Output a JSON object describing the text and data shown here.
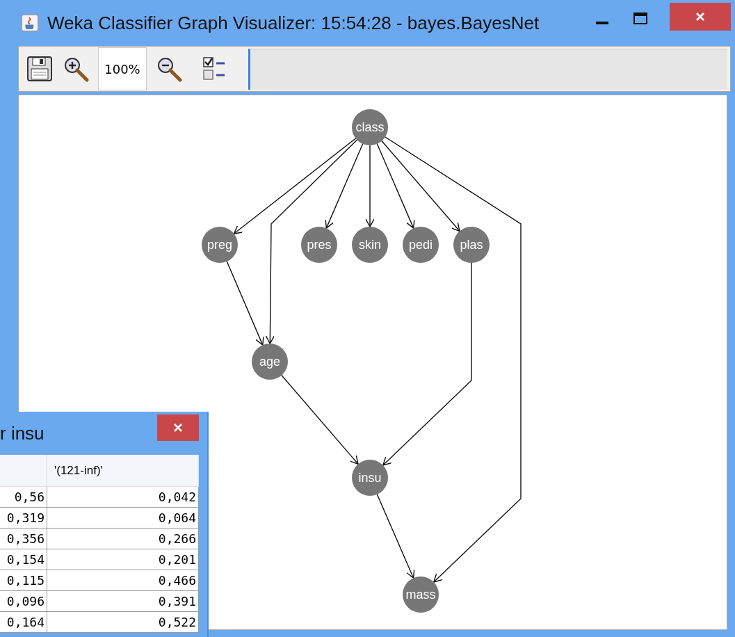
{
  "window": {
    "title": "Weka Classifier Graph Visualizer: 15:54:28 - bayes.BayesNet"
  },
  "toolbar": {
    "zoom": "100%"
  },
  "graph": {
    "nodes": [
      "class",
      "preg",
      "pres",
      "skin",
      "pedi",
      "plas",
      "age",
      "insu",
      "mass"
    ]
  },
  "table_window": {
    "title": "r insu",
    "columns": [
      "",
      "'(121-inf)'"
    ],
    "rows": [
      [
        "0,56",
        "0,042"
      ],
      [
        "0,319",
        "0,064"
      ],
      [
        "0,356",
        "0,266"
      ],
      [
        "0,154",
        "0,201"
      ],
      [
        "0,115",
        "0,466"
      ],
      [
        "0,096",
        "0,391"
      ],
      [
        "0,164",
        "0,522"
      ]
    ]
  }
}
